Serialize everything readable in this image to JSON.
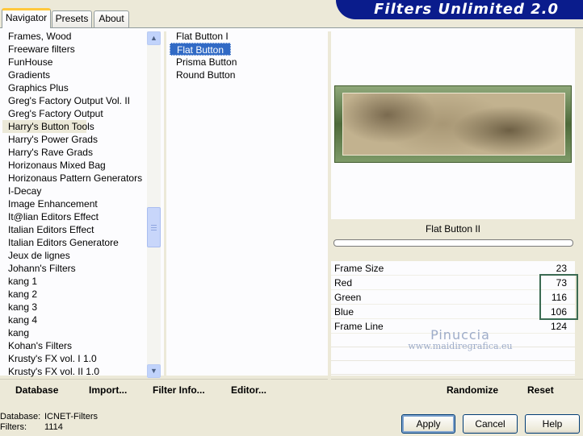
{
  "tabs": [
    {
      "label": "Navigator",
      "active": true
    },
    {
      "label": "Presets",
      "active": false
    },
    {
      "label": "About",
      "active": false
    }
  ],
  "banner": {
    "title": "Filters Unlimited 2.0",
    "color": "#0a1c8c"
  },
  "categories": {
    "items": [
      "Frames, Wood",
      "Freeware filters",
      "FunHouse",
      "Gradients",
      "Graphics Plus",
      "Greg's Factory Output Vol. II",
      "Greg's Factory Output",
      "Harry's Button Tools",
      "Harry's Power Grads",
      "Harry's Rave Grads",
      "Horizonaus Mixed Bag",
      "Horizonaus Pattern Generators",
      "I-Decay",
      "Image Enhancement",
      "It@lian Editors Effect",
      "Italian Editors Effect",
      "Italian Editors Generatore",
      "Jeux de lignes",
      "Johann's Filters",
      "kang 1",
      "kang 2",
      "kang 3",
      "kang 4",
      "kang",
      "Kohan's Filters",
      "Krusty's FX vol. I 1.0",
      "Krusty's FX vol. II 1.0"
    ],
    "selected": "Harry's Button Tools"
  },
  "filters": {
    "items": [
      "Flat Button I",
      "Flat Button II",
      "Prisma Button",
      "Round Button"
    ],
    "selected": "Flat Button II"
  },
  "preview": {
    "filter_name": "Flat Button II",
    "progress": 0
  },
  "params": [
    {
      "name": "Frame Size",
      "value": "23"
    },
    {
      "name": "Red",
      "value": "73"
    },
    {
      "name": "Green",
      "value": "116"
    },
    {
      "name": "Blue",
      "value": "106"
    },
    {
      "name": "Frame Line",
      "value": "124"
    }
  ],
  "watermark": {
    "line1": "Pinuccia",
    "line2": "www.maidiregrafica.eu"
  },
  "toolbar": {
    "database": "Database",
    "import": "Import...",
    "filter_info": "Filter Info...",
    "editor": "Editor...",
    "randomize": "Randomize",
    "reset": "Reset"
  },
  "status": {
    "database_label": "Database:",
    "database_value": "ICNET-Filters",
    "filters_label": "Filters:",
    "filters_value": "1114"
  },
  "buttons": {
    "apply": "Apply",
    "cancel": "Cancel",
    "help": "Help"
  },
  "colors": {
    "selection": "#316ac5",
    "active_tab_accent": "#ffc83c",
    "highlight_box": "#3a6a52"
  }
}
